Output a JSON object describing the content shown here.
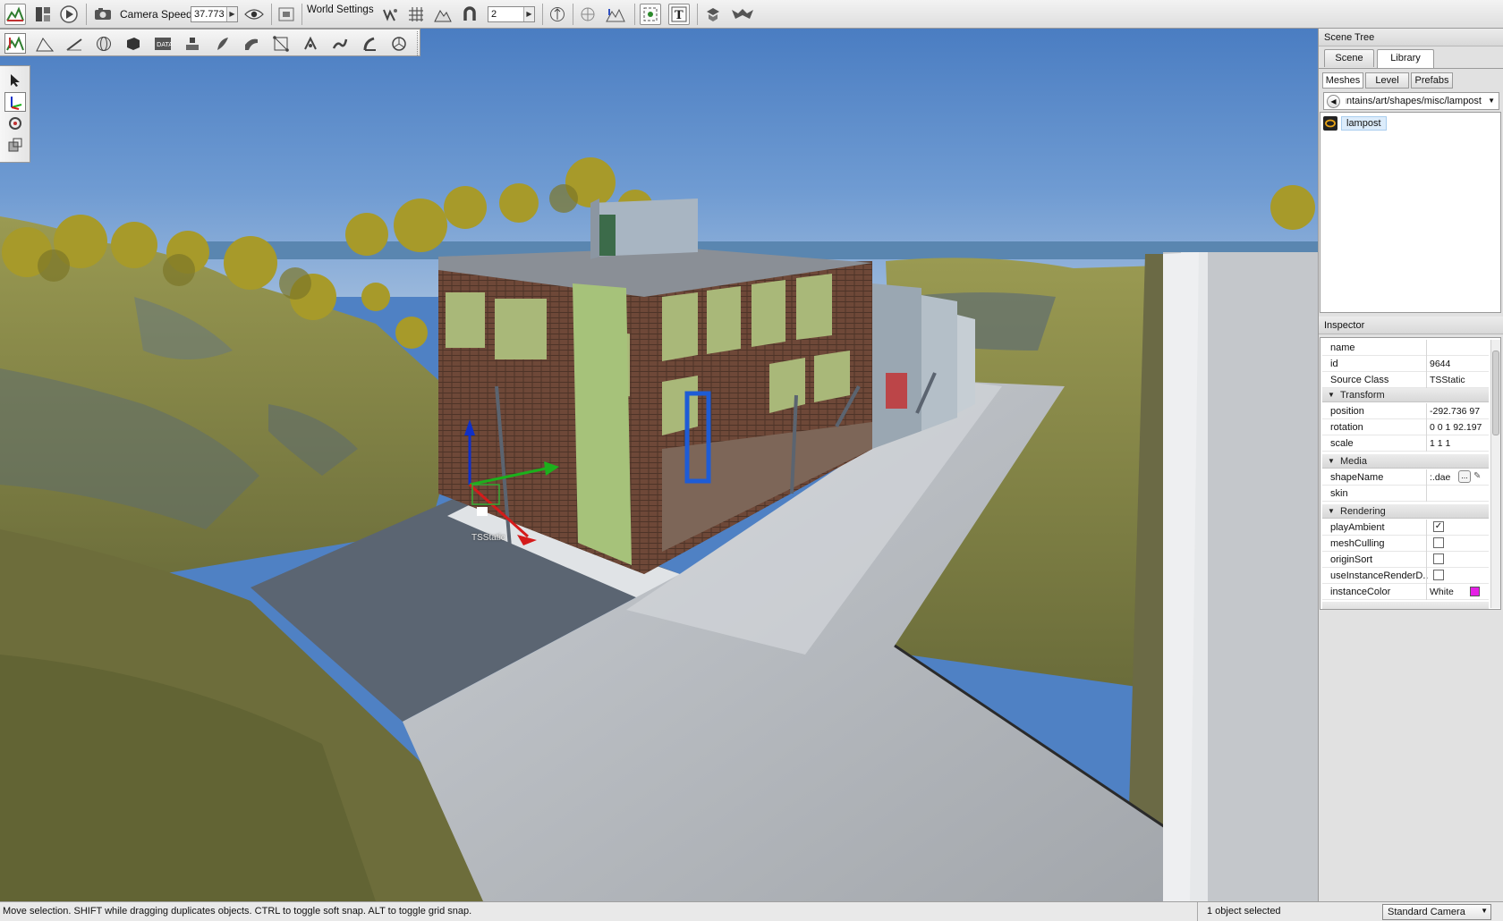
{
  "toolbar": {
    "camera_speed_label": "Camera Speed",
    "camera_speed_value": "37.773",
    "world_settings_label": "World Settings",
    "grid_size_value": "2"
  },
  "viewport": {
    "gizmo_label": "TSStatic"
  },
  "scene_tree": {
    "title": "Scene Tree",
    "tabs": [
      "Scene",
      "Library"
    ],
    "active_tab": "Library",
    "subtabs": [
      "Meshes",
      "Level",
      "Prefabs"
    ],
    "active_subtab": "Meshes",
    "path": "mountains/art/shapes/misc/lampost",
    "items": [
      {
        "label": "lampost",
        "icon": "mesh-icon"
      }
    ]
  },
  "inspector": {
    "title": "Inspector",
    "fields": {
      "name": {
        "label": "name",
        "value": ""
      },
      "id": {
        "label": "id",
        "value": "9644"
      },
      "source_class": {
        "label": "Source Class",
        "value": "TSStatic"
      }
    },
    "groups": {
      "transform": {
        "label": "Transform",
        "position": {
          "label": "position",
          "value": "-292.736 97"
        },
        "rotation": {
          "label": "rotation",
          "value": "0 0 1 92.197"
        },
        "scale": {
          "label": "scale",
          "value": "1 1 1"
        }
      },
      "media": {
        "label": "Media",
        "shape_name": {
          "label": "shapeName",
          "value": ":.dae",
          "button": "..."
        },
        "skin": {
          "label": "skin",
          "value": ""
        }
      },
      "rendering": {
        "label": "Rendering",
        "play_ambient": {
          "label": "playAmbient",
          "checked": true
        },
        "mesh_culling": {
          "label": "meshCulling",
          "checked": false
        },
        "origin_sort": {
          "label": "originSort",
          "checked": false
        },
        "use_instance_render": {
          "label": "useInstanceRenderD...",
          "checked": false
        },
        "instance_color": {
          "label": "instanceColor",
          "value": "White",
          "swatch": "#e51fe5"
        }
      }
    }
  },
  "status": {
    "message": "Move selection.  SHIFT while dragging duplicates objects.  CTRL to toggle soft snap.  ALT to toggle grid snap.",
    "selection": "1 object selected",
    "camera": "Standard Camera"
  },
  "colors": {
    "sky": "#4f81c4",
    "grass": "#8a8a45",
    "road": "#a9adb2",
    "building_brick": "#6c4a3a",
    "building_panel": "#a9b879",
    "selection_blue": "#1e5cd6"
  }
}
